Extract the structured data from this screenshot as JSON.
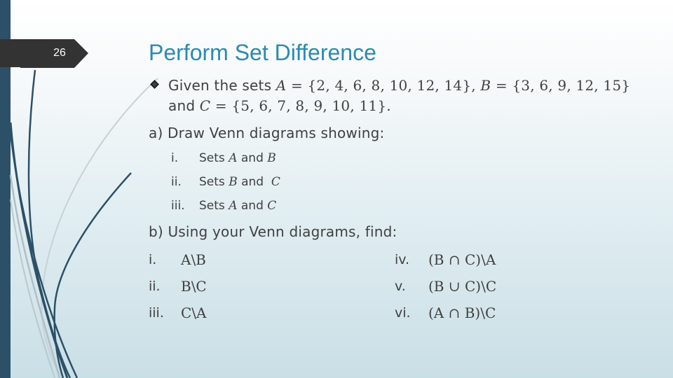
{
  "slide": {
    "number": "26",
    "title": "Perform Set Difference"
  },
  "colors": {
    "accent_title": "#2a8bb0",
    "left_bar": "#2c5068",
    "number_tab": "#333333",
    "body_text": "#404040"
  },
  "intro": {
    "bullet_icon": "diamond-bullet",
    "line1_text": "Given the sets ",
    "set_a_label": "A",
    "set_a_values": " = {2, 4, 6, 8, 10, 12, 14}, ",
    "set_b_label": "B",
    "set_b_values": " = {3, 6, 9, 12, 15}",
    "line2_text": "and ",
    "set_c_label": "C",
    "set_c_values": " = {5, 6, 7, 8, 9, 10, 11}."
  },
  "part_a": {
    "heading": "a)  Draw Venn diagrams showing:",
    "items": [
      {
        "numeral": "i.",
        "prefix": "Sets ",
        "first": "A",
        "and": " and ",
        "second": "B"
      },
      {
        "numeral": "ii.",
        "prefix": "Sets ",
        "first": "B",
        "and": " and  ",
        "second": "C"
      },
      {
        "numeral": "iii.",
        "prefix": "Sets ",
        "first": "A",
        "and": " and ",
        "second": "C"
      }
    ]
  },
  "part_b": {
    "heading": "b)  Using your Venn diagrams, find:",
    "left_items": [
      {
        "numeral": "i.",
        "expression": "A\\B"
      },
      {
        "numeral": "ii.",
        "expression": "B\\C"
      },
      {
        "numeral": "iii.",
        "expression": "C\\A"
      }
    ],
    "right_items": [
      {
        "numeral": "iv.",
        "expression": "(B ∩ C)\\A"
      },
      {
        "numeral": "v.",
        "expression": "(B ∪ C)\\C"
      },
      {
        "numeral": "vi.",
        "expression": "(A ∩ B)\\C"
      }
    ]
  }
}
